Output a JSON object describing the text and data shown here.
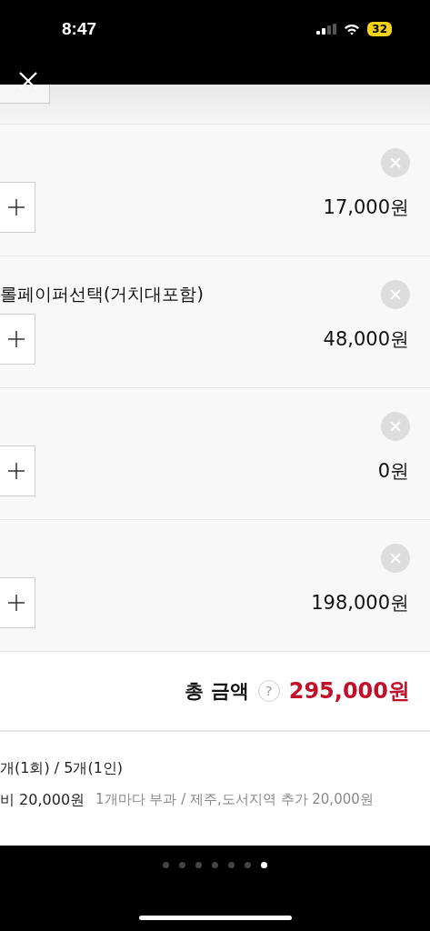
{
  "status_bar": {
    "time": "8:47",
    "battery": "32"
  },
  "items": [
    {
      "price": "17,000원"
    },
    {
      "name": "롤페이퍼선택(거치대포함)",
      "price": "48,000원"
    },
    {
      "price": "0원"
    },
    {
      "price": "198,000원"
    }
  ],
  "total": {
    "label": "총 금액",
    "help": "?",
    "amount": "295,000원"
  },
  "shipping": {
    "limit": "개(1회) / 5개(1인)",
    "fee": "비 20,000원",
    "note": "1개마다 부과 / 제주,도서지역 추가 20,000원"
  },
  "pager": [
    {
      "selected": false
    },
    {
      "selected": false
    },
    {
      "selected": false
    },
    {
      "selected": false
    },
    {
      "selected": false
    },
    {
      "selected": false
    },
    {
      "selected": true
    }
  ]
}
